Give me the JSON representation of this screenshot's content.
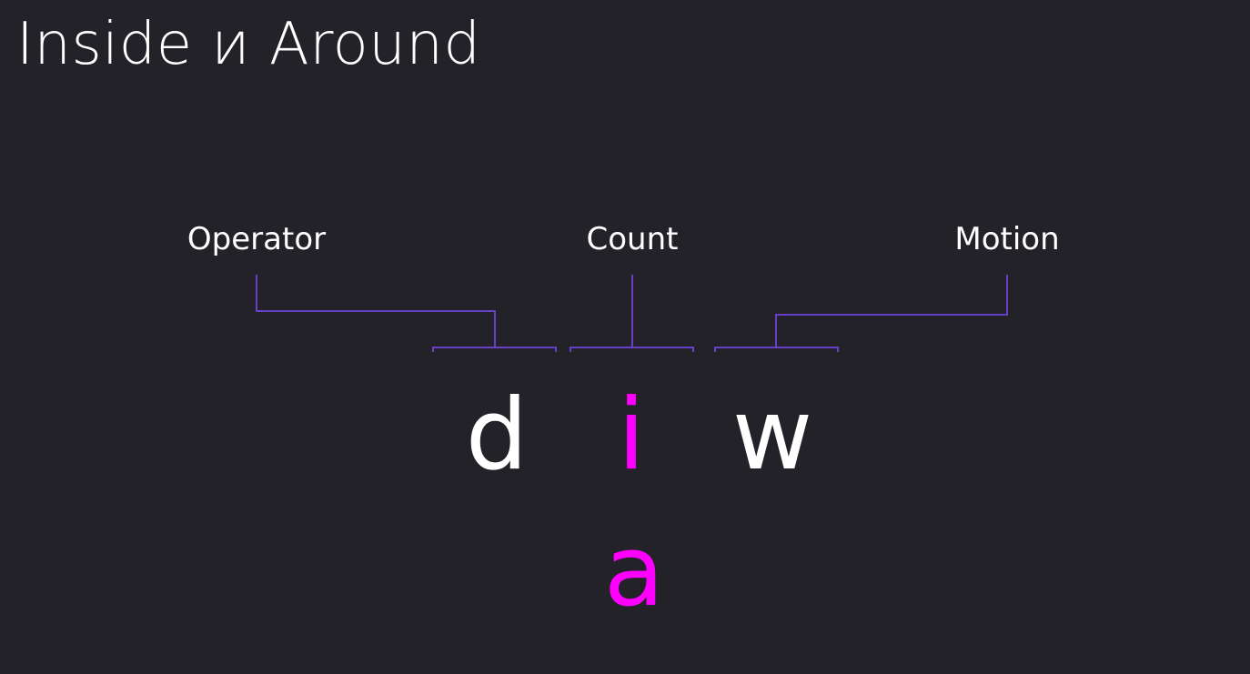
{
  "title": "Inside и Around",
  "labels": {
    "operator": "Operator",
    "count": "Count",
    "motion": "Motion"
  },
  "command": {
    "operator": "d",
    "count_primary": "i",
    "motion": "w",
    "count_alternate": "a"
  },
  "colors": {
    "background": "#232229",
    "text": "#ffffff",
    "accent": "#ff00ff",
    "connector": "#6a3fc7"
  }
}
